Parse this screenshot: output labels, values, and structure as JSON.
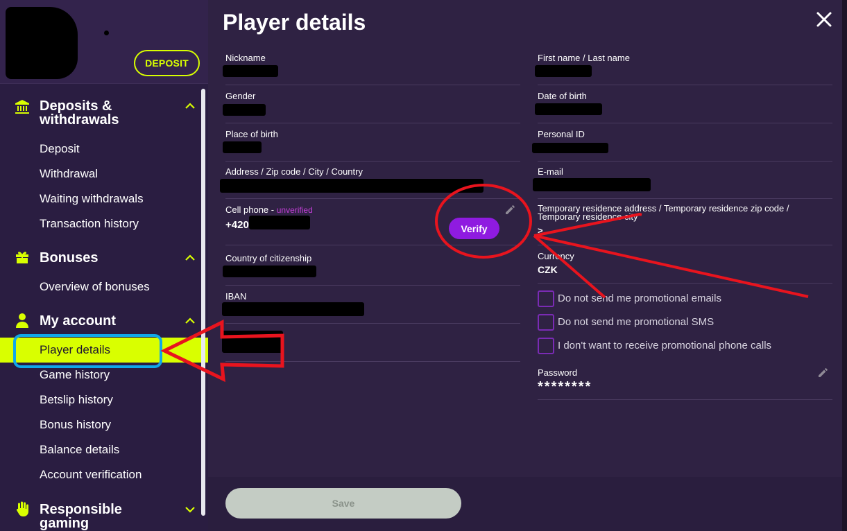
{
  "sidebar": {
    "deposit_button": "DEPOSIT",
    "sections": [
      {
        "title_line1": "Deposits &",
        "title_line2": "withdrawals",
        "icon": "bank-icon",
        "expanded": true,
        "items": [
          "Deposit",
          "Withdrawal",
          "Waiting withdrawals",
          "Transaction history"
        ]
      },
      {
        "title_line1": "Bonuses",
        "icon": "gift-icon",
        "expanded": true,
        "items": [
          "Overview of bonuses"
        ]
      },
      {
        "title_line1": "My account",
        "icon": "user-icon",
        "expanded": true,
        "items": [
          "Player details",
          "Game history",
          "Betslip history",
          "Bonus history",
          "Balance details",
          "Account verification"
        ]
      },
      {
        "title_line1": "Responsible",
        "title_line2": "gaming",
        "icon": "hand-icon",
        "expanded": false
      }
    ],
    "active_item": "Player details"
  },
  "main": {
    "title": "Player details",
    "left_fields": [
      {
        "label": "Nickname"
      },
      {
        "label": "Gender"
      },
      {
        "label": "Place of birth"
      },
      {
        "label": "Address / Zip code / City / Country"
      },
      {
        "label": "Cell phone - ",
        "status": "unverified",
        "value": "+420",
        "action": "Verify"
      },
      {
        "label": "Country of citizenship"
      },
      {
        "label": "IBAN"
      }
    ],
    "right_fields": [
      {
        "label": "First name / Last name"
      },
      {
        "label": "Date of birth"
      },
      {
        "label": "Personal ID"
      },
      {
        "label": "E-mail"
      },
      {
        "label": "Temporary residence address / Temporary residence zip code / Temporary residence city",
        "value": ">"
      },
      {
        "label": "Currency",
        "value": "CZK"
      }
    ],
    "checkboxes": [
      "Do not send me promotional emails",
      "Do not send me promotional SMS",
      "I don't want to receive promotional phone calls"
    ],
    "password": {
      "label": "Password",
      "value": "********"
    },
    "save_button": "Save"
  },
  "colors": {
    "accent": "#d9ff00",
    "verify": "#8f1be0",
    "annotation_red": "#e8141e",
    "annotation_blue": "#10a8e8"
  }
}
